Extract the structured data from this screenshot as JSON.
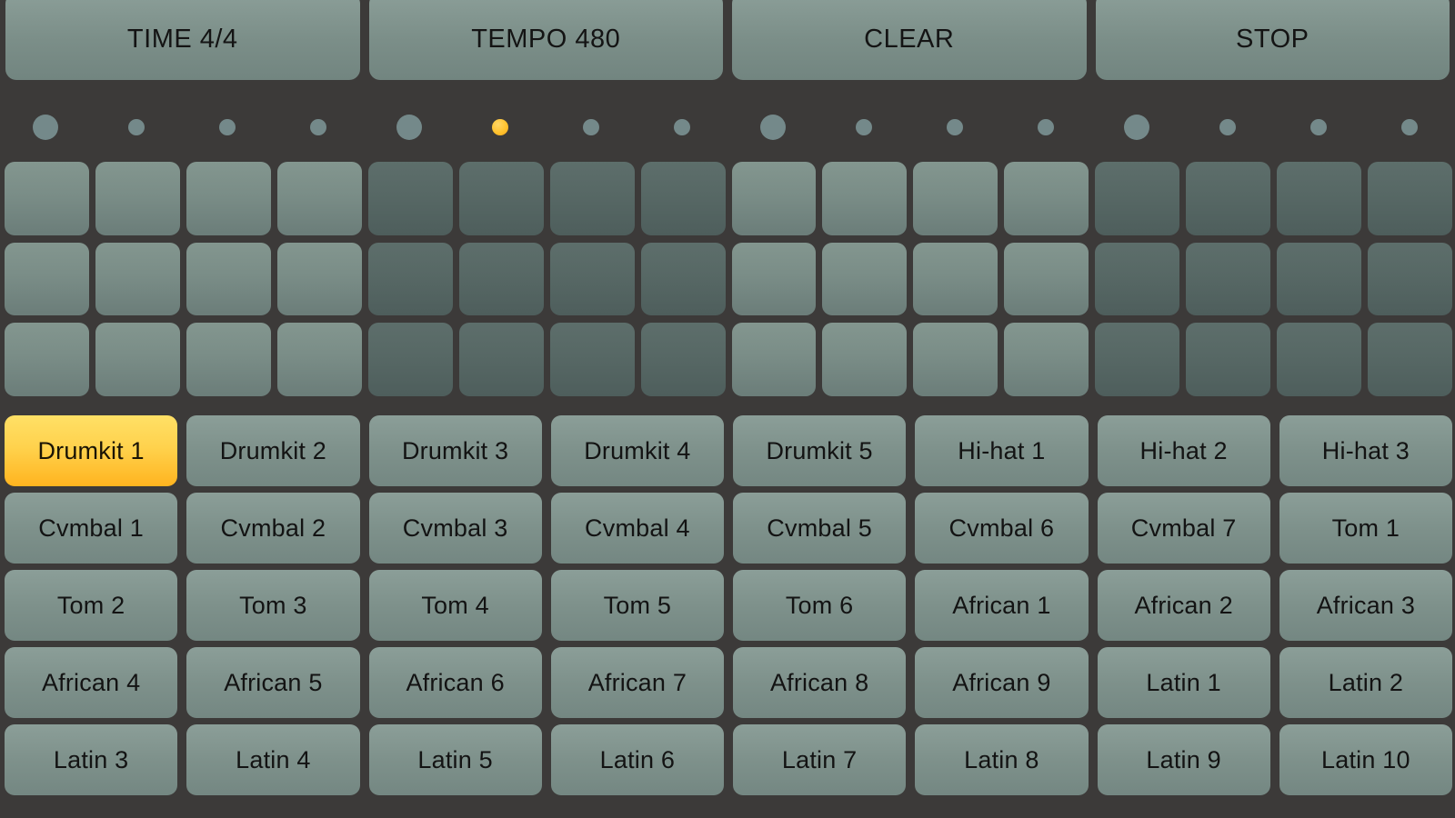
{
  "app": {
    "title": "Drum Machine Sequencer",
    "background_color": "#3c3a39",
    "pad_light_color": "#7d918c",
    "pad_dark_color": "#5a6b68",
    "accent_color": "#ffc233",
    "button_color": "#7e918b"
  },
  "transport": {
    "buttons": [
      {
        "label": "TIME 4/4",
        "name": "time-signature-button"
      },
      {
        "label": "TEMPO 480",
        "name": "tempo-button"
      },
      {
        "label": "CLEAR",
        "name": "clear-button"
      },
      {
        "label": "STOP",
        "name": "stop-button"
      }
    ]
  },
  "step_indicator": {
    "total_steps": 16,
    "active_step": 6,
    "beat_steps": [
      1,
      5,
      9,
      13
    ],
    "leds": [
      {
        "step": 1,
        "beat": true,
        "active": false
      },
      {
        "step": 2,
        "beat": false,
        "active": false
      },
      {
        "step": 3,
        "beat": false,
        "active": false
      },
      {
        "step": 4,
        "beat": false,
        "active": false
      },
      {
        "step": 5,
        "beat": true,
        "active": false
      },
      {
        "step": 6,
        "beat": false,
        "active": true
      },
      {
        "step": 7,
        "beat": false,
        "active": false
      },
      {
        "step": 8,
        "beat": false,
        "active": false
      },
      {
        "step": 9,
        "beat": true,
        "active": false
      },
      {
        "step": 10,
        "beat": false,
        "active": false
      },
      {
        "step": 11,
        "beat": false,
        "active": false
      },
      {
        "step": 12,
        "beat": false,
        "active": false
      },
      {
        "step": 13,
        "beat": true,
        "active": false
      },
      {
        "step": 14,
        "beat": false,
        "active": false
      },
      {
        "step": 15,
        "beat": false,
        "active": false
      },
      {
        "step": 16,
        "beat": false,
        "active": false
      }
    ]
  },
  "step_grid": {
    "rows": 3,
    "columns": 16,
    "group_size": 4,
    "group_shading": [
      "light",
      "dark",
      "light",
      "dark"
    ],
    "cells": [
      [
        "light",
        "light",
        "light",
        "light",
        "dark",
        "dark",
        "dark",
        "dark",
        "light",
        "light",
        "light",
        "light",
        "dark",
        "dark",
        "dark",
        "dark"
      ],
      [
        "light",
        "light",
        "light",
        "light",
        "dark",
        "dark",
        "dark",
        "dark",
        "light",
        "light",
        "light",
        "light",
        "dark",
        "dark",
        "dark",
        "dark"
      ],
      [
        "light",
        "light",
        "light",
        "light",
        "dark",
        "dark",
        "dark",
        "dark",
        "light",
        "light",
        "light",
        "light",
        "dark",
        "dark",
        "dark",
        "dark"
      ]
    ]
  },
  "sound_grid": {
    "columns": 8,
    "selected": "Drumkit 1",
    "rows": [
      [
        "Drumkit 1",
        "Drumkit 2",
        "Drumkit 3",
        "Drumkit 4",
        "Drumkit 5",
        "Hi-hat 1",
        "Hi-hat 2",
        "Hi-hat 3"
      ],
      [
        "Cvmbal 1",
        "Cvmbal 2",
        "Cvmbal 3",
        "Cvmbal 4",
        "Cvmbal 5",
        "Cvmbal 6",
        "Cvmbal 7",
        "Tom 1"
      ],
      [
        "Tom 2",
        "Tom 3",
        "Tom 4",
        "Tom 5",
        "Tom 6",
        "African 1",
        "African 2",
        "African 3"
      ],
      [
        "African 4",
        "African 5",
        "African 6",
        "African 7",
        "African 8",
        "African 9",
        "Latin 1",
        "Latin 2"
      ],
      [
        "Latin 3",
        "Latin 4",
        "Latin 5",
        "Latin 6",
        "Latin 7",
        "Latin 8",
        "Latin 9",
        "Latin 10"
      ]
    ]
  }
}
